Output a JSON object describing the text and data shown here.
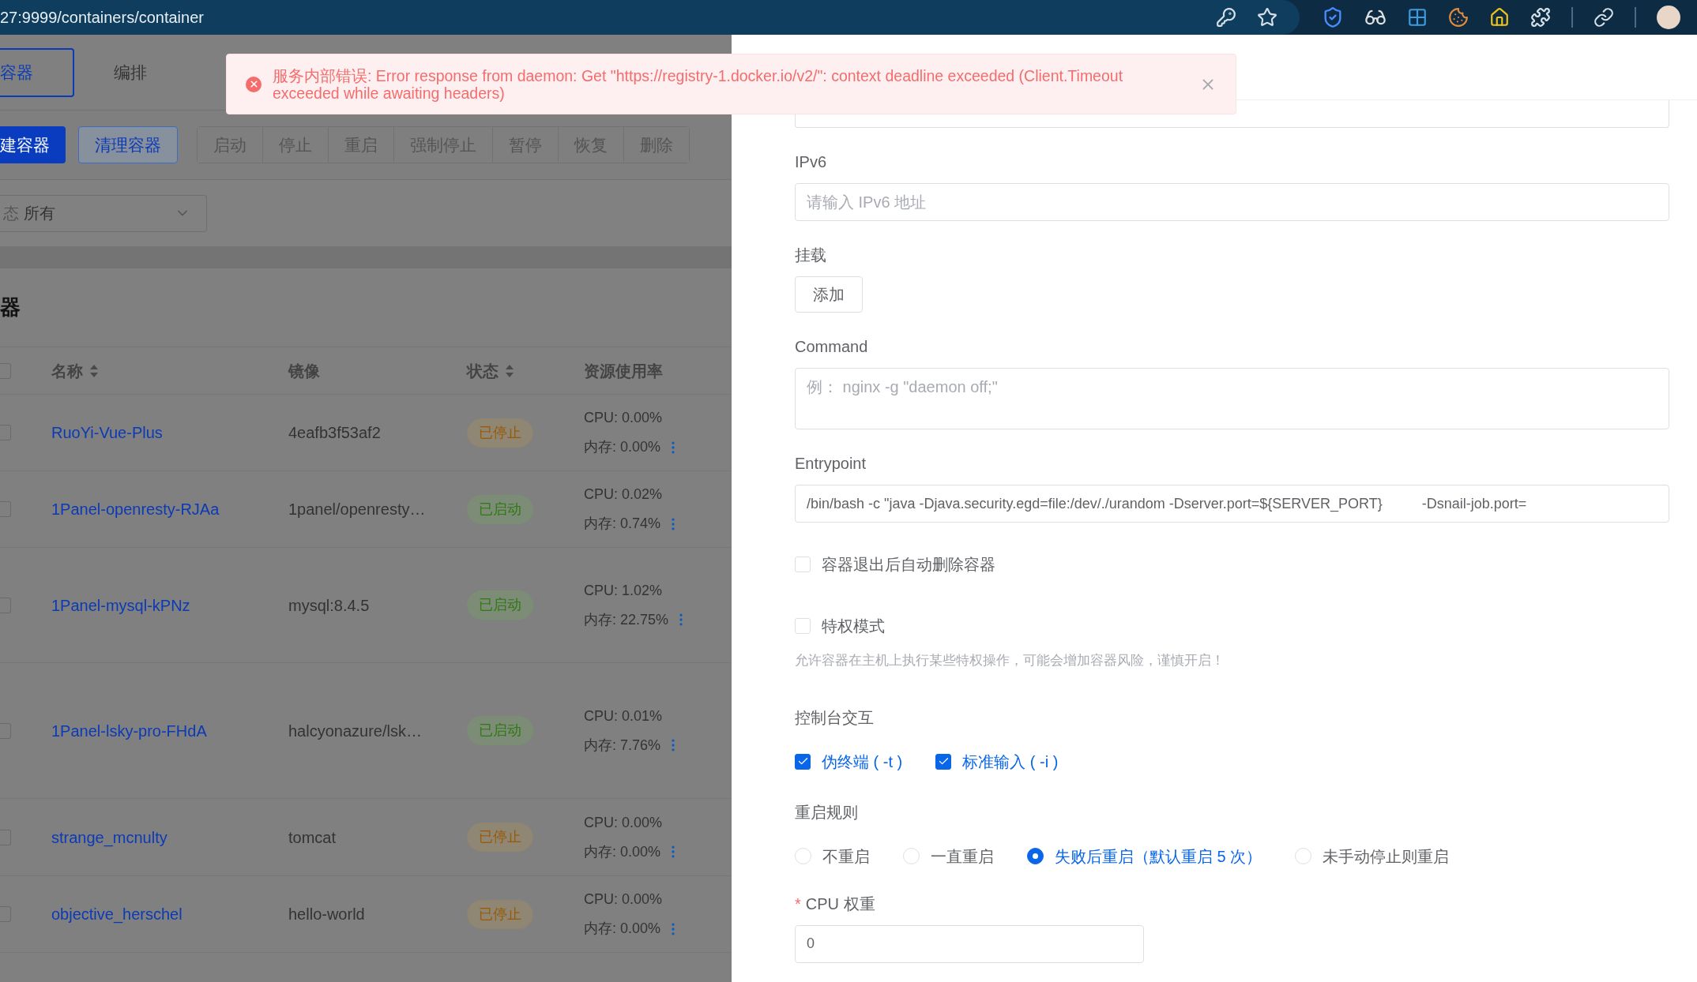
{
  "browser": {
    "url": "27:9999/containers/container"
  },
  "error_toast": {
    "message": "服务内部错误: Error response from daemon: Get \"https://registry-1.docker.io/v2/\": context deadline exceeded (Client.Timeout exceeded while awaiting headers)"
  },
  "tabs": [
    {
      "label": "容器",
      "selected": true
    },
    {
      "label": "编排",
      "selected": false
    }
  ],
  "toolbar": [
    {
      "label": "建容器",
      "kind": "primary"
    },
    {
      "label": "清理容器",
      "kind": "plain"
    },
    {
      "label": "启动",
      "kind": "group"
    },
    {
      "label": "停止",
      "kind": "group"
    },
    {
      "label": "重启",
      "kind": "group"
    },
    {
      "label": "强制停止",
      "kind": "group"
    },
    {
      "label": "暂停",
      "kind": "group"
    },
    {
      "label": "恢复",
      "kind": "group"
    },
    {
      "label": "删除",
      "kind": "group"
    }
  ],
  "filter": {
    "label": "态",
    "value": "所有"
  },
  "card_title": "器",
  "table": {
    "header_checked": false,
    "columns": [
      {
        "label": "名称",
        "sortable": true
      },
      {
        "label": "镜像",
        "sortable": false
      },
      {
        "label": "状态",
        "sortable": true
      },
      {
        "label": "资源使用率",
        "sortable": false
      }
    ],
    "rows": [
      {
        "checked": false,
        "name": "RuoYi-Vue-Plus",
        "image": "4eafb3f53af2",
        "status": {
          "label": "已停止",
          "kind": "stopped"
        },
        "cpu": "CPU: 0.00%",
        "memory": "内存: 0.00%"
      },
      {
        "checked": false,
        "name": "1Panel-openresty-RJAa",
        "image": "1panel/openresty…",
        "status": {
          "label": "已启动",
          "kind": "running"
        },
        "cpu": "CPU: 0.02%",
        "memory": "内存: 0.74%"
      },
      {
        "checked": false,
        "name": "1Panel-mysql-kPNz",
        "image": "mysql:8.4.5",
        "status": {
          "label": "已启动",
          "kind": "running"
        },
        "cpu": "CPU: 1.02%",
        "memory": "内存: 22.75%"
      },
      {
        "checked": false,
        "name": "1Panel-lsky-pro-FHdA",
        "image": "halcyonazure/lsk…",
        "status": {
          "label": "已启动",
          "kind": "running"
        },
        "cpu": "CPU: 0.01%",
        "memory": "内存: 7.76%"
      },
      {
        "checked": false,
        "name": "strange_mcnulty",
        "image": "tomcat",
        "status": {
          "label": "已停止",
          "kind": "stopped"
        },
        "cpu": "CPU: 0.00%",
        "memory": "内存: 0.00%"
      },
      {
        "checked": false,
        "name": "objective_herschel",
        "image": "hello-world",
        "status": {
          "label": "已停止",
          "kind": "stopped"
        },
        "cpu": "CPU: 0.00%",
        "memory": "内存: 0.00%"
      }
    ]
  },
  "form": [
    {
      "kind": "input",
      "label": "IPv6",
      "placeholder": "请输入 IPv6 地址"
    },
    {
      "kind": "button",
      "label": "挂载",
      "button": "添加"
    },
    {
      "kind": "textarea",
      "label": "Command",
      "placeholder": "例： nginx -g \"daemon off;\""
    },
    {
      "kind": "input",
      "label": "Entrypoint",
      "value": "/bin/bash -c \"java -Djava.security.egd=file:/dev/./urandom -Dserver.port=${SERVER_PORT}          -Dsnail-job.port="
    },
    {
      "kind": "checkbox",
      "label": "容器退出后自动删除容器",
      "checked": false
    },
    {
      "kind": "checkbox",
      "label": "特权模式",
      "checked": false
    },
    {
      "kind": "hint",
      "text": "允许容器在主机上执行某些特权操作，可能会增加容器风险，谨慎开启！"
    },
    {
      "kind": "checkbox_group",
      "label": "控制台交互",
      "options": [
        {
          "label": "伪终端 ( -t )",
          "checked": true
        },
        {
          "label": "标准输入 ( -i )",
          "checked": true
        }
      ]
    },
    {
      "kind": "radio_group",
      "label": "重启规则",
      "options": [
        {
          "label": "不重启",
          "selected": false
        },
        {
          "label": "一直重启",
          "selected": false
        },
        {
          "label": "失败后重启（默认重启 5 次）",
          "selected": true
        },
        {
          "label": "未手动停止则重启",
          "selected": false
        }
      ]
    },
    {
      "kind": "number_input",
      "label": "CPU 权重",
      "required_mark": "*",
      "value": "0"
    }
  ]
}
